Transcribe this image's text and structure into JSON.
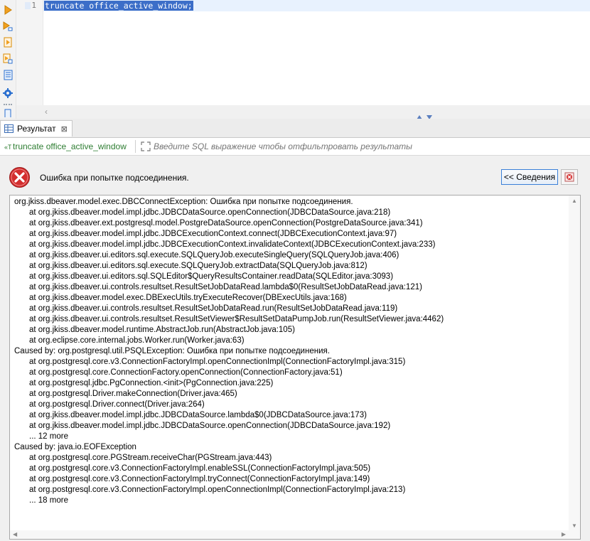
{
  "editor": {
    "line_number": "1",
    "code_line": "truncate office_active_window;"
  },
  "toolbar": {
    "icons": [
      "run-statement-icon",
      "run-statement-new-tab-icon",
      "execute-script-icon",
      "execute-script-new-tabs-icon",
      "explain-plan-icon",
      "settings-icon",
      "more-icon"
    ]
  },
  "results": {
    "tab_label": "Результат",
    "tab_close": "⊠",
    "query_label": "truncate office_active_window",
    "filter_placeholder": "Введите SQL выражение чтобы отфильтровать результаты"
  },
  "error": {
    "message": "Ошибка при попытке подсоединения.",
    "details_button": "<< Сведения",
    "stacktrace": [
      {
        "text": "org.jkiss.dbeaver.model.exec.DBCConnectException: Ошибка при попытке подсоединения.",
        "indent": false
      },
      {
        "text": "at org.jkiss.dbeaver.model.impl.jdbc.JDBCDataSource.openConnection(JDBCDataSource.java:218)",
        "indent": true
      },
      {
        "text": "at org.jkiss.dbeaver.ext.postgresql.model.PostgreDataSource.openConnection(PostgreDataSource.java:341)",
        "indent": true
      },
      {
        "text": "at org.jkiss.dbeaver.model.impl.jdbc.JDBCExecutionContext.connect(JDBCExecutionContext.java:97)",
        "indent": true
      },
      {
        "text": "at org.jkiss.dbeaver.model.impl.jdbc.JDBCExecutionContext.invalidateContext(JDBCExecutionContext.java:233)",
        "indent": true
      },
      {
        "text": "at org.jkiss.dbeaver.ui.editors.sql.execute.SQLQueryJob.executeSingleQuery(SQLQueryJob.java:406)",
        "indent": true
      },
      {
        "text": "at org.jkiss.dbeaver.ui.editors.sql.execute.SQLQueryJob.extractData(SQLQueryJob.java:812)",
        "indent": true
      },
      {
        "text": "at org.jkiss.dbeaver.ui.editors.sql.SQLEditor$QueryResultsContainer.readData(SQLEditor.java:3093)",
        "indent": true
      },
      {
        "text": "at org.jkiss.dbeaver.ui.controls.resultset.ResultSetJobDataRead.lambda$0(ResultSetJobDataRead.java:121)",
        "indent": true
      },
      {
        "text": "at org.jkiss.dbeaver.model.exec.DBExecUtils.tryExecuteRecover(DBExecUtils.java:168)",
        "indent": true
      },
      {
        "text": "at org.jkiss.dbeaver.ui.controls.resultset.ResultSetJobDataRead.run(ResultSetJobDataRead.java:119)",
        "indent": true
      },
      {
        "text": "at org.jkiss.dbeaver.ui.controls.resultset.ResultSetViewer$ResultSetDataPumpJob.run(ResultSetViewer.java:4462)",
        "indent": true
      },
      {
        "text": "at org.jkiss.dbeaver.model.runtime.AbstractJob.run(AbstractJob.java:105)",
        "indent": true
      },
      {
        "text": "at org.eclipse.core.internal.jobs.Worker.run(Worker.java:63)",
        "indent": true
      },
      {
        "text": "Caused by: org.postgresql.util.PSQLException: Ошибка при попытке подсоединения.",
        "indent": false
      },
      {
        "text": "at org.postgresql.core.v3.ConnectionFactoryImpl.openConnectionImpl(ConnectionFactoryImpl.java:315)",
        "indent": true
      },
      {
        "text": "at org.postgresql.core.ConnectionFactory.openConnection(ConnectionFactory.java:51)",
        "indent": true
      },
      {
        "text": "at org.postgresql.jdbc.PgConnection.<init>(PgConnection.java:225)",
        "indent": true
      },
      {
        "text": "at org.postgresql.Driver.makeConnection(Driver.java:465)",
        "indent": true
      },
      {
        "text": "at org.postgresql.Driver.connect(Driver.java:264)",
        "indent": true
      },
      {
        "text": "at org.jkiss.dbeaver.model.impl.jdbc.JDBCDataSource.lambda$0(JDBCDataSource.java:173)",
        "indent": true
      },
      {
        "text": "at org.jkiss.dbeaver.model.impl.jdbc.JDBCDataSource.openConnection(JDBCDataSource.java:192)",
        "indent": true
      },
      {
        "text": "... 12 more",
        "indent": true
      },
      {
        "text": "Caused by: java.io.EOFException",
        "indent": false
      },
      {
        "text": "at org.postgresql.core.PGStream.receiveChar(PGStream.java:443)",
        "indent": true
      },
      {
        "text": "at org.postgresql.core.v3.ConnectionFactoryImpl.enableSSL(ConnectionFactoryImpl.java:505)",
        "indent": true
      },
      {
        "text": "at org.postgresql.core.v3.ConnectionFactoryImpl.tryConnect(ConnectionFactoryImpl.java:149)",
        "indent": true
      },
      {
        "text": "at org.postgresql.core.v3.ConnectionFactoryImpl.openConnectionImpl(ConnectionFactoryImpl.java:213)",
        "indent": true
      },
      {
        "text": "... 18 more",
        "indent": true
      }
    ]
  },
  "colors": {
    "selection": "#3c6ec8",
    "error_red": "#d32f2f",
    "accent_blue": "#3a80d8",
    "run_orange": "#f0a020",
    "query_green": "#2e7d32"
  }
}
